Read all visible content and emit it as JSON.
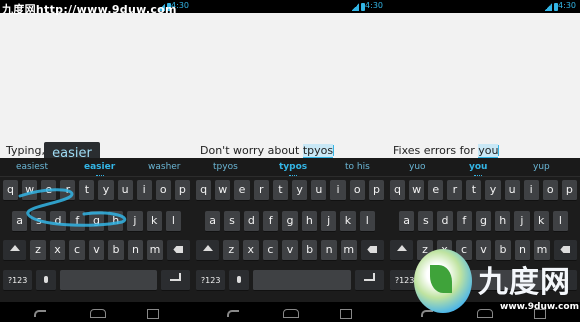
{
  "watermark": {
    "text": "九度网http://www.9duw.com",
    "logo_text": "九度网",
    "logo_url": "www.9duw.com"
  },
  "status": {
    "time": "4:30"
  },
  "colors": {
    "accent": "#33b5e5",
    "key": "#3f4144",
    "keyboard_bg": "#1c1c1c"
  },
  "panels": [
    {
      "text_before": "Typing, jus",
      "text_highlight": "",
      "text_after": "",
      "popup": "easier",
      "suggestions": [
        "easiest",
        "easier",
        "washer"
      ]
    },
    {
      "text_before": "Don't worry about ",
      "text_highlight": "tpyos",
      "text_after": "",
      "popup": "",
      "suggestions": [
        "tpyos",
        "typos",
        "to his"
      ]
    },
    {
      "text_before": "Fixes errors for ",
      "text_highlight": "you",
      "text_after": "",
      "popup": "",
      "suggestions": [
        "yuo",
        "you",
        "yup"
      ]
    }
  ],
  "keys": {
    "row1": [
      "q",
      "w",
      "e",
      "r",
      "t",
      "y",
      "u",
      "i",
      "o",
      "p"
    ],
    "row2": [
      "a",
      "s",
      "d",
      "f",
      "g",
      "h",
      "j",
      "k",
      "l"
    ],
    "row3": [
      "z",
      "x",
      "c",
      "v",
      "b",
      "n",
      "m"
    ],
    "symbols_label": "?123"
  },
  "icons": [
    "signal-icon",
    "battery-icon",
    "shift-icon",
    "delete-icon",
    "mic-icon",
    "enter-icon",
    "back-icon",
    "home-icon",
    "recent-apps-icon"
  ]
}
